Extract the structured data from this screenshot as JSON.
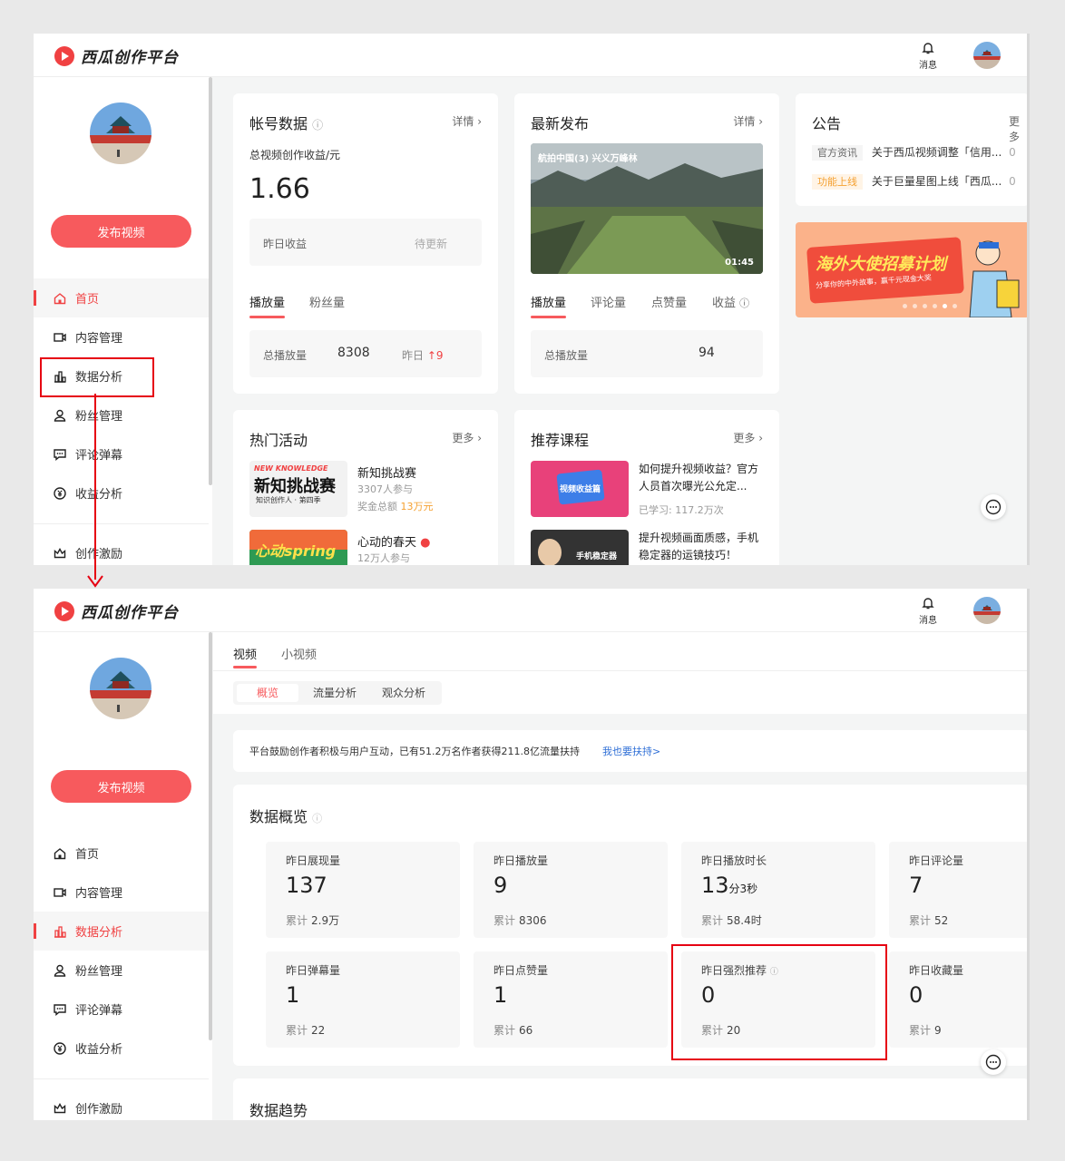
{
  "app": {
    "name": "西瓜创作平台",
    "message_label": "消息"
  },
  "sidebar": {
    "publish_label": "发布视频",
    "items": [
      {
        "label": "首页"
      },
      {
        "label": "内容管理"
      },
      {
        "label": "数据分析"
      },
      {
        "label": "粉丝管理"
      },
      {
        "label": "评论弹幕"
      },
      {
        "label": "收益分析"
      },
      {
        "label": "创作激励"
      }
    ]
  },
  "home": {
    "account": {
      "title": "帐号数据",
      "detail": "详情 ›",
      "earnings_label": "总视频创作收益/元",
      "earnings_value": "1.66",
      "yesterday_label": "昨日收益",
      "yesterday_status": "待更新",
      "tabs": [
        "播放量",
        "粉丝量"
      ],
      "total_play_label": "总播放量",
      "total_play_value": "8308",
      "yesterday_prefix": "昨日",
      "yesterday_delta": "9"
    },
    "latest": {
      "title": "最新发布",
      "detail": "详情 ›",
      "video_title": "航拍中国(3) 兴义万峰林",
      "duration": "01:45",
      "tabs": [
        "播放量",
        "评论量",
        "点赞量",
        "收益"
      ],
      "total_play_label": "总播放量",
      "total_play_value": "94"
    },
    "notice": {
      "title": "公告",
      "more": "更多",
      "items": [
        {
          "tag": "官方资讯",
          "text": "关于西瓜视频调整「信用...",
          "tail": "0"
        },
        {
          "tag": "功能上线",
          "text": "关于巨量星图上线「西瓜...",
          "tail": "0"
        }
      ]
    },
    "banner": {
      "headline": "海外大使招募计划",
      "subline": "分享你的中外故事，赢千元现金大奖"
    },
    "events": {
      "title": "热门活动",
      "more": "更多 ›",
      "items": [
        {
          "thumb_top": "NEW KNOWLEDGE",
          "thumb_main": "新知挑战赛",
          "thumb_sub": "知识创作人 · 第四季",
          "name": "新知挑战赛",
          "participants": "3307人参与",
          "prize_label": "奖金总额",
          "prize_value": "13万元"
        },
        {
          "thumb_main": "心动spring",
          "name": "心动的春天",
          "participants": "12万人参与"
        }
      ]
    },
    "courses": {
      "title": "推荐课程",
      "more": "更多 ›",
      "items": [
        {
          "thumb_text": "视频收益篇",
          "title": "如何提升视频收益？官方人员首次曝光公允定...",
          "learned": "已学习: 117.2万次"
        },
        {
          "thumb_text": "手机稳定器",
          "title": "提升视频画面质感，手机稳定器的运镜技巧！"
        }
      ]
    }
  },
  "analytics": {
    "tabs": [
      "视频",
      "小视频"
    ],
    "subtabs": [
      "概览",
      "流量分析",
      "观众分析"
    ],
    "notice_text": "平台鼓励创作者积极与用户互动，已有51.2万名作者获得211.8亿流量扶持",
    "notice_link": "我也要扶持>",
    "overview_title": "数据概览",
    "total_label": "累计",
    "stats": [
      {
        "label": "昨日展现量",
        "value": "137",
        "unit": "",
        "total": "2.9万"
      },
      {
        "label": "昨日播放量",
        "value": "9",
        "unit": "",
        "total": "8306"
      },
      {
        "label": "昨日播放时长",
        "value": "13",
        "unit": "分3秒",
        "total": "58.4时"
      },
      {
        "label": "昨日评论量",
        "value": "7",
        "unit": "",
        "total": "52"
      },
      {
        "label": "昨日弹幕量",
        "value": "1",
        "unit": "",
        "total": "22"
      },
      {
        "label": "昨日点赞量",
        "value": "1",
        "unit": "",
        "total": "66"
      },
      {
        "label": "昨日强烈推荐",
        "value": "0",
        "unit": "",
        "total": "20"
      },
      {
        "label": "昨日收藏量",
        "value": "0",
        "unit": "",
        "total": "9"
      }
    ],
    "trend_title": "数据趋势"
  },
  "colors": {
    "accent": "#f75a5d",
    "highlight": "#e60012",
    "link": "#2f6fd6"
  }
}
